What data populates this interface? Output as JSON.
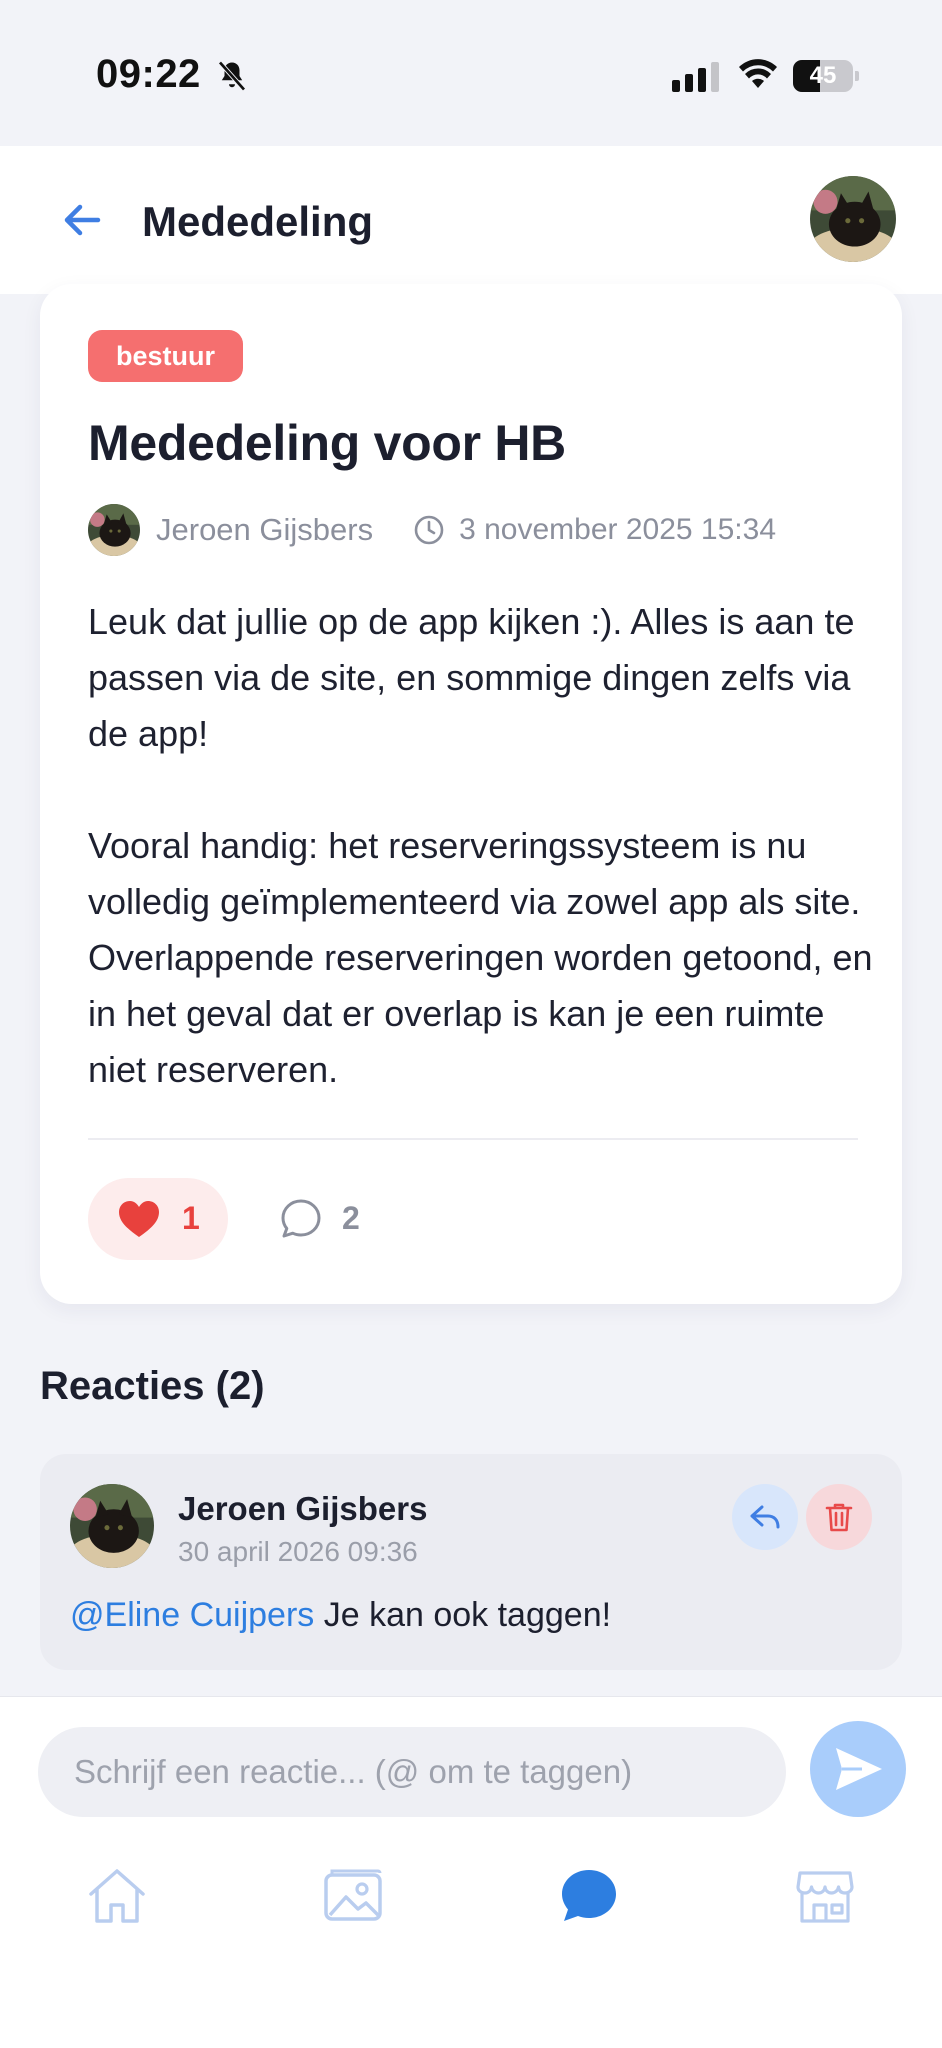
{
  "status_bar": {
    "time": "09:22",
    "battery": "45",
    "battery_level": 0.45
  },
  "header": {
    "title": "Mededeling"
  },
  "post": {
    "tag": "bestuur",
    "title": "Mededeling voor HB",
    "author": "Jeroen Gijsbers",
    "date": "3 november 2025 15:34",
    "body_paragraph_1": "Leuk dat jullie op de app kijken :). Alles is aan te passen via de site, en sommige dingen zelfs via de app!",
    "body_paragraph_2": "Vooral handig: het reserveringssysteem is nu volledig geïmplementeerd via zowel app als site. Overlappende reserveringen worden getoond, en in het geval dat er overlap is kan je een ruimte niet reserveren.",
    "likes": "1",
    "comments": "2"
  },
  "reactions": {
    "title": "Reacties (2)",
    "items": [
      {
        "author": "Jeroen Gijsbers",
        "date": "30 april 2026 09:36",
        "mention": "@Eline Cuijpers",
        "text": " Je kan ook taggen!"
      }
    ]
  },
  "composer": {
    "placeholder": "Schrijf een reactie... (@ om te taggen)"
  },
  "nav": {
    "items": [
      {
        "icon": "home-icon"
      },
      {
        "icon": "gallery-icon"
      },
      {
        "icon": "chat-icon",
        "active": true
      },
      {
        "icon": "store-icon"
      }
    ]
  },
  "colors": {
    "accent": "#2d7ee0",
    "tag": "#f56f6f",
    "like": "#e8413d"
  }
}
